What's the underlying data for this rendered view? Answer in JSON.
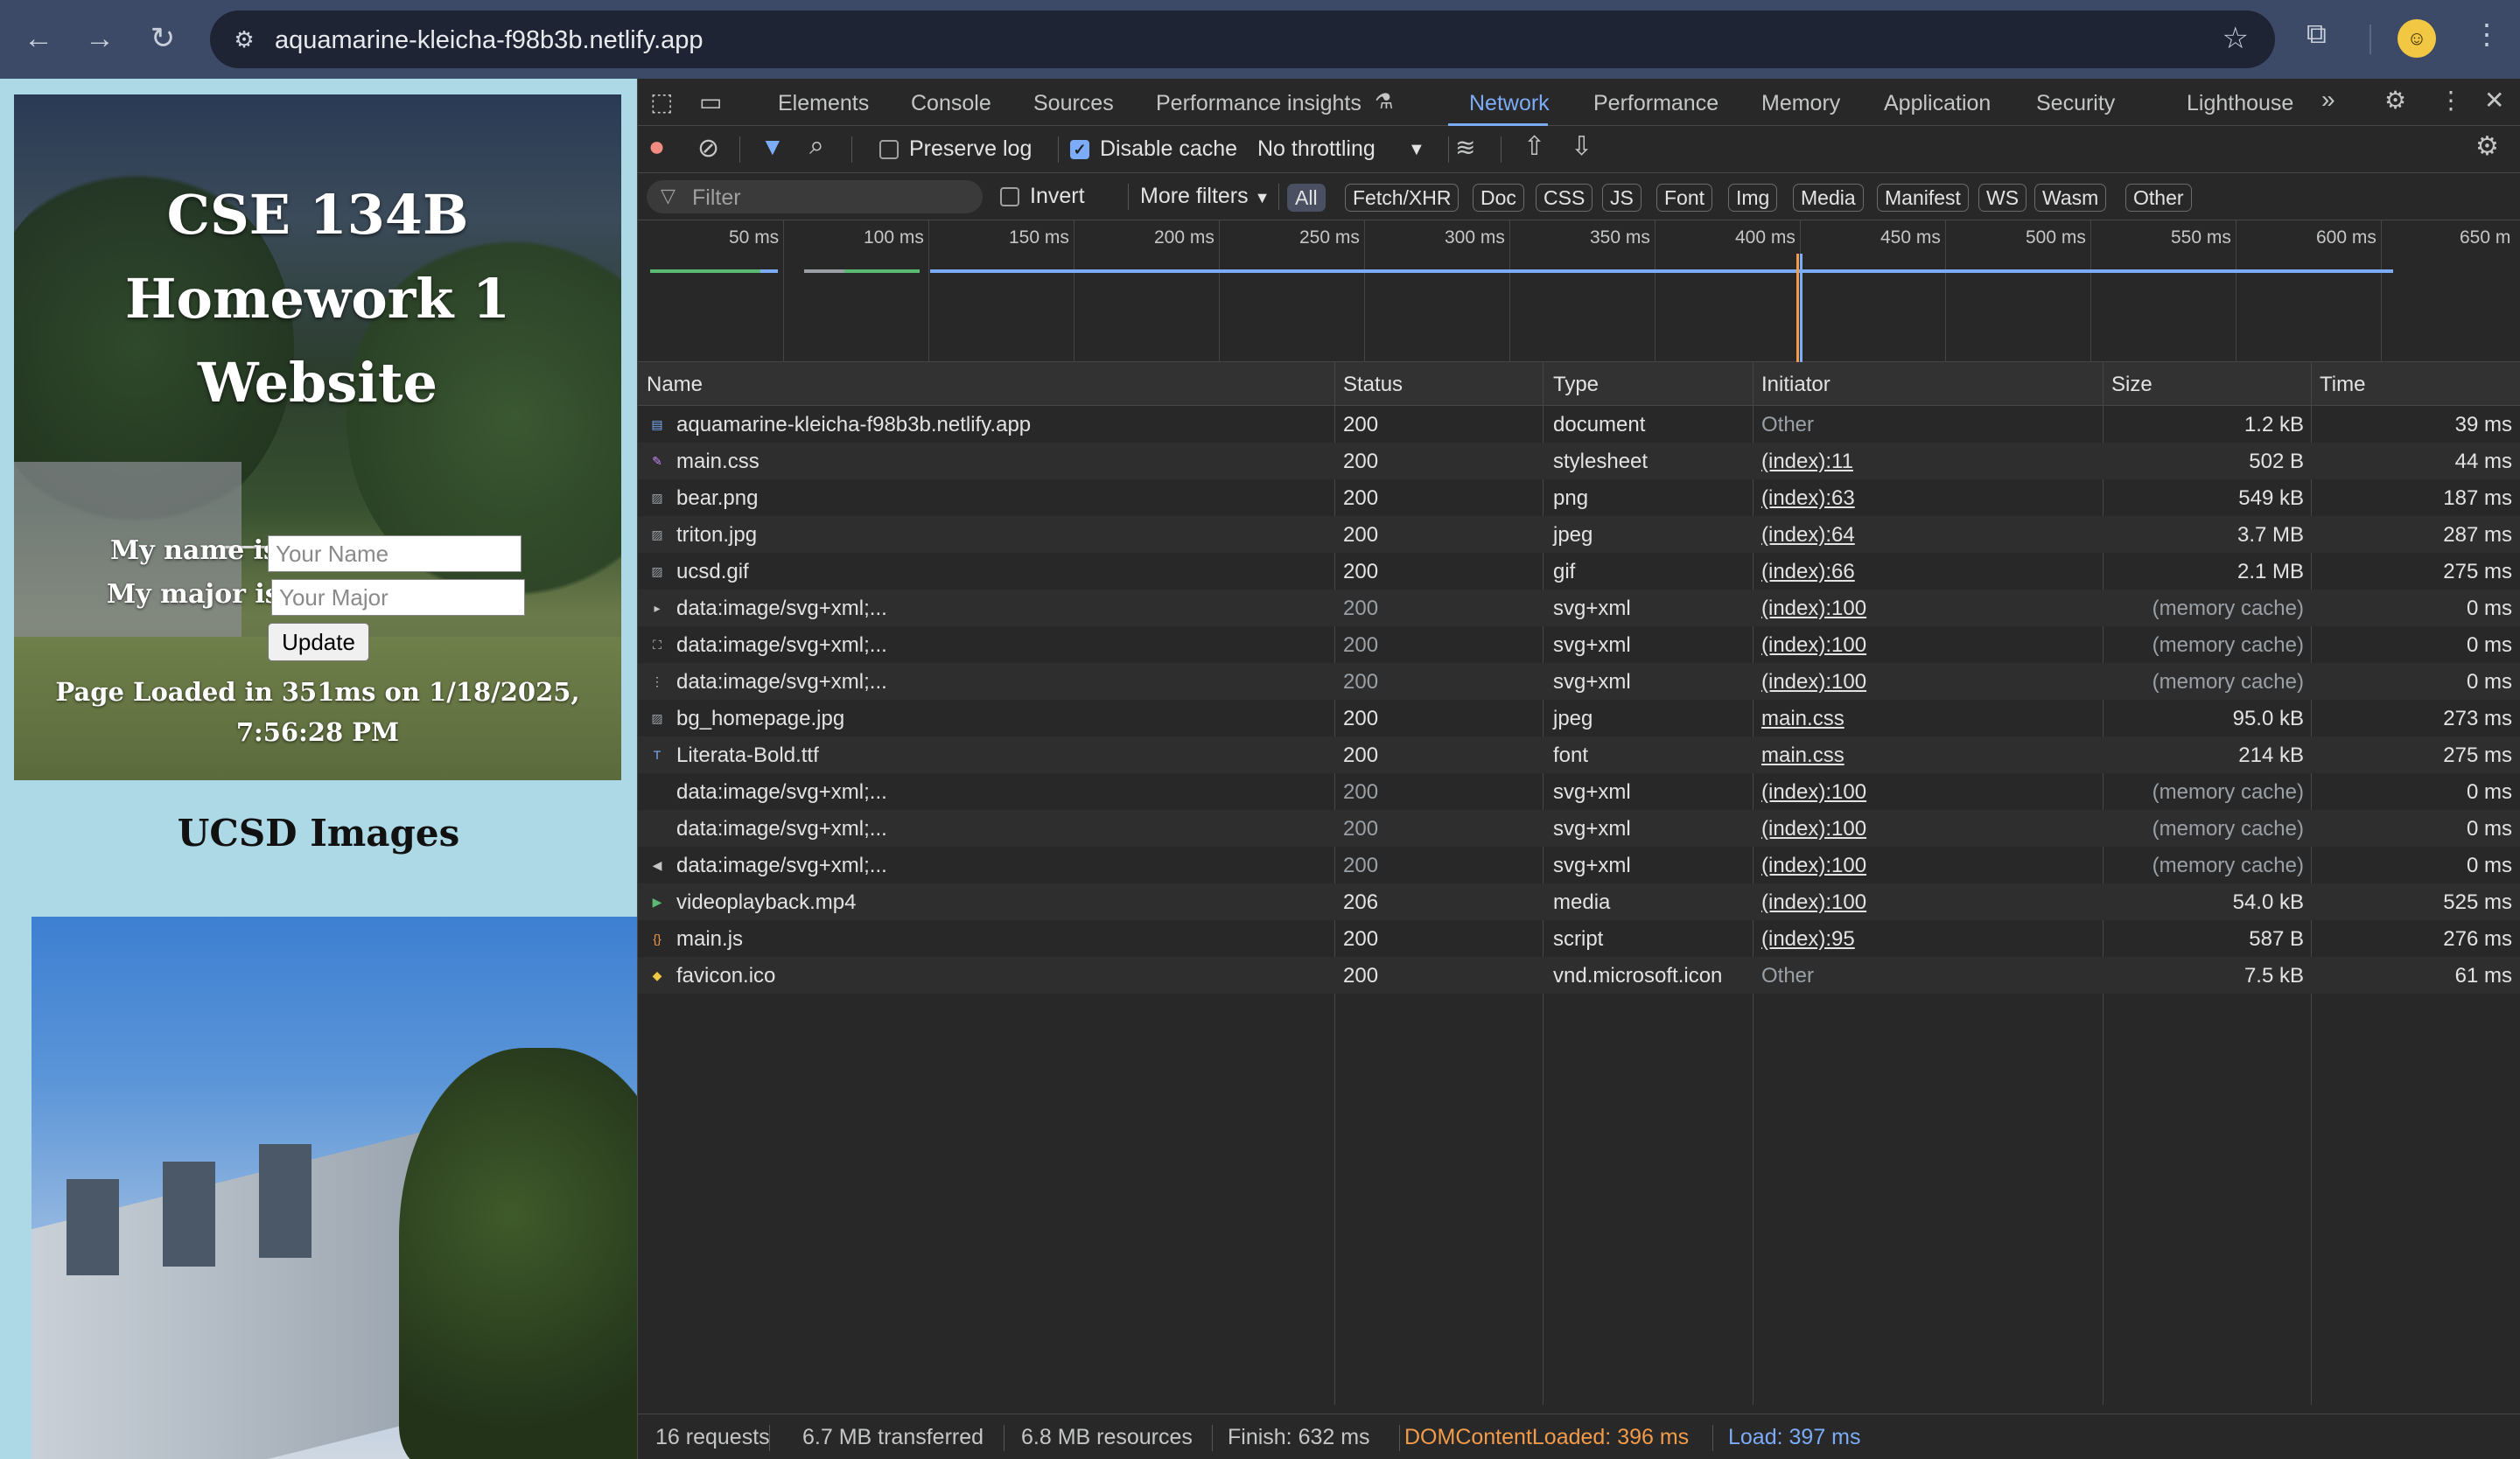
{
  "browser": {
    "url": "aquamarine-kleicha-f98b3b.netlify.app"
  },
  "page": {
    "title": "CSE 134B Homework 1 Website",
    "name_label": "My name is",
    "name_placeholder": "Your Name",
    "major_label": "My major is",
    "major_placeholder": "Your Major",
    "update_button": "Update",
    "loaded_text": "Page Loaded in 351ms on 1/18/2025, 7:56:28 PM",
    "images_heading": "UCSD Images"
  },
  "devtools": {
    "tabs": [
      "Elements",
      "Console",
      "Sources",
      "Performance insights",
      "Network",
      "Performance",
      "Memory",
      "Application",
      "Security",
      "Lighthouse"
    ],
    "active_tab": "Network",
    "toolbar": {
      "preserve_log": "Preserve log",
      "disable_cache": "Disable cache",
      "throttling": "No throttling"
    },
    "filter": {
      "placeholder": "Filter",
      "invert": "Invert",
      "more_filters": "More filters",
      "types": [
        "All",
        "Fetch/XHR",
        "Doc",
        "CSS",
        "JS",
        "Font",
        "Img",
        "Media",
        "Manifest",
        "WS",
        "Wasm",
        "Other"
      ]
    },
    "overview_ticks": [
      "50 ms",
      "100 ms",
      "150 ms",
      "200 ms",
      "250 ms",
      "300 ms",
      "350 ms",
      "400 ms",
      "450 ms",
      "500 ms",
      "550 ms",
      "600 ms",
      "650 m"
    ],
    "columns": {
      "name": "Name",
      "status": "Status",
      "type": "Type",
      "initiator": "Initiator",
      "size": "Size",
      "time": "Time"
    },
    "requests": [
      {
        "name": "aquamarine-kleicha-f98b3b.netlify.app",
        "status": "200",
        "type": "document",
        "initiator": "Other",
        "size": "1.2 kB",
        "time": "39 ms",
        "icon": "document-icon"
      },
      {
        "name": "main.css",
        "status": "200",
        "type": "stylesheet",
        "initiator": "(index):11",
        "size": "502 B",
        "time": "44 ms",
        "icon": "stylesheet-icon"
      },
      {
        "name": "bear.png",
        "status": "200",
        "type": "png",
        "initiator": "(index):63",
        "size": "549 kB",
        "time": "187 ms",
        "icon": "image-icon"
      },
      {
        "name": "triton.jpg",
        "status": "200",
        "type": "jpeg",
        "initiator": "(index):64",
        "size": "3.7 MB",
        "time": "287 ms",
        "icon": "image-icon"
      },
      {
        "name": "ucsd.gif",
        "status": "200",
        "type": "gif",
        "initiator": "(index):66",
        "size": "2.1 MB",
        "time": "275 ms",
        "icon": "image-icon"
      },
      {
        "name": "data:image/svg+xml;...",
        "status": "200",
        "type": "svg+xml",
        "initiator": "(index):100",
        "size": "(memory cache)",
        "time": "0 ms",
        "icon": "play-icon"
      },
      {
        "name": "data:image/svg+xml;...",
        "status": "200",
        "type": "svg+xml",
        "initiator": "(index):100",
        "size": "(memory cache)",
        "time": "0 ms",
        "icon": "fullscreen-icon"
      },
      {
        "name": "data:image/svg+xml;...",
        "status": "200",
        "type": "svg+xml",
        "initiator": "(index):100",
        "size": "(memory cache)",
        "time": "0 ms",
        "icon": "more-icon"
      },
      {
        "name": "bg_homepage.jpg",
        "status": "200",
        "type": "jpeg",
        "initiator": "main.css",
        "size": "95.0 kB",
        "time": "273 ms",
        "icon": "image-icon"
      },
      {
        "name": "Literata-Bold.ttf",
        "status": "200",
        "type": "font",
        "initiator": "main.css",
        "size": "214 kB",
        "time": "275 ms",
        "icon": "font-icon"
      },
      {
        "name": "data:image/svg+xml;...",
        "status": "200",
        "type": "svg+xml",
        "initiator": "(index):100",
        "size": "(memory cache)",
        "time": "0 ms",
        "icon": "blank-icon"
      },
      {
        "name": "data:image/svg+xml;...",
        "status": "200",
        "type": "svg+xml",
        "initiator": "(index):100",
        "size": "(memory cache)",
        "time": "0 ms",
        "icon": "blank-icon"
      },
      {
        "name": "data:image/svg+xml;...",
        "status": "200",
        "type": "svg+xml",
        "initiator": "(index):100",
        "size": "(memory cache)",
        "time": "0 ms",
        "icon": "volume-icon"
      },
      {
        "name": "videoplayback.mp4",
        "status": "206",
        "type": "media",
        "initiator": "(index):100",
        "size": "54.0 kB",
        "time": "525 ms",
        "icon": "media-icon"
      },
      {
        "name": "main.js",
        "status": "200",
        "type": "script",
        "initiator": "(index):95",
        "size": "587 B",
        "time": "276 ms",
        "icon": "script-icon"
      },
      {
        "name": "favicon.ico",
        "status": "200",
        "type": "vnd.microsoft.icon",
        "initiator": "Other",
        "size": "7.5 kB",
        "time": "61 ms",
        "icon": "favicon-icon"
      }
    ],
    "status_bar": {
      "requests": "16 requests",
      "transferred": "6.7 MB transferred",
      "resources": "6.8 MB resources",
      "finish": "Finish: 632 ms",
      "dom_content_loaded": "DOMContentLoaded: 396 ms",
      "load": "Load: 397 ms"
    },
    "colors": {
      "accent": "#7cacf8",
      "dcl": "#f29b4a",
      "load": "#7cacf8"
    }
  }
}
